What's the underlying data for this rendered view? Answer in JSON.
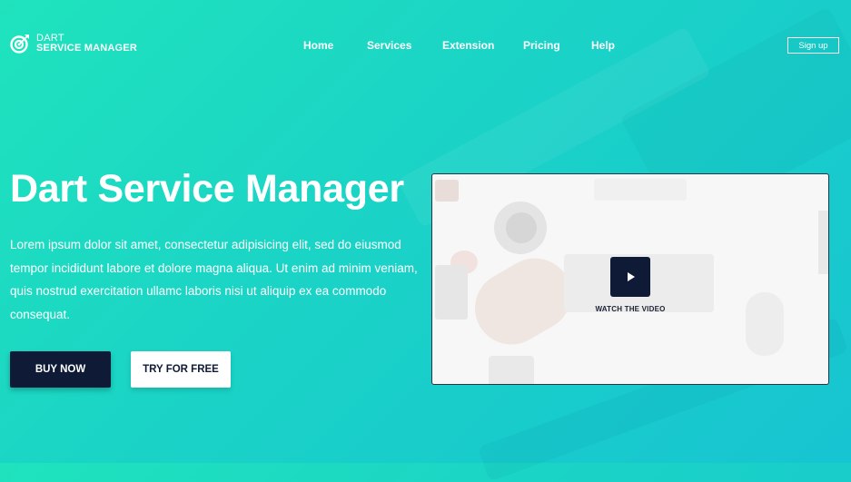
{
  "brand": {
    "line1": "DART",
    "line2": "SERVICE MANAGER"
  },
  "nav": {
    "items": [
      {
        "label": "Home"
      },
      {
        "label": "Services"
      },
      {
        "label": "Extension"
      },
      {
        "label": "Pricing"
      },
      {
        "label": "Help"
      }
    ],
    "signup_label": "Sign up"
  },
  "hero": {
    "title": "Dart Service Manager",
    "description": "Lorem ipsum dolor sit amet, consectetur adipisicing elit, sed do eiusmod tempor incididunt labore et dolore magna aliqua. Ut enim ad minim veniam, quis nostrud exercitation ullamc laboris nisi ut aliquip ex ea commodo consequat.",
    "buy_label": "BUY NOW",
    "try_label": "TRY FOR FREE"
  },
  "video": {
    "caption": "WATCH THE VIDEO"
  },
  "colors": {
    "background_start": "#1fe3bd",
    "background_end": "#17c4d2",
    "dark_navy": "#0e1a36",
    "white": "#ffffff"
  },
  "icons": {
    "logo": "target-arrow-icon",
    "play": "play-icon"
  }
}
